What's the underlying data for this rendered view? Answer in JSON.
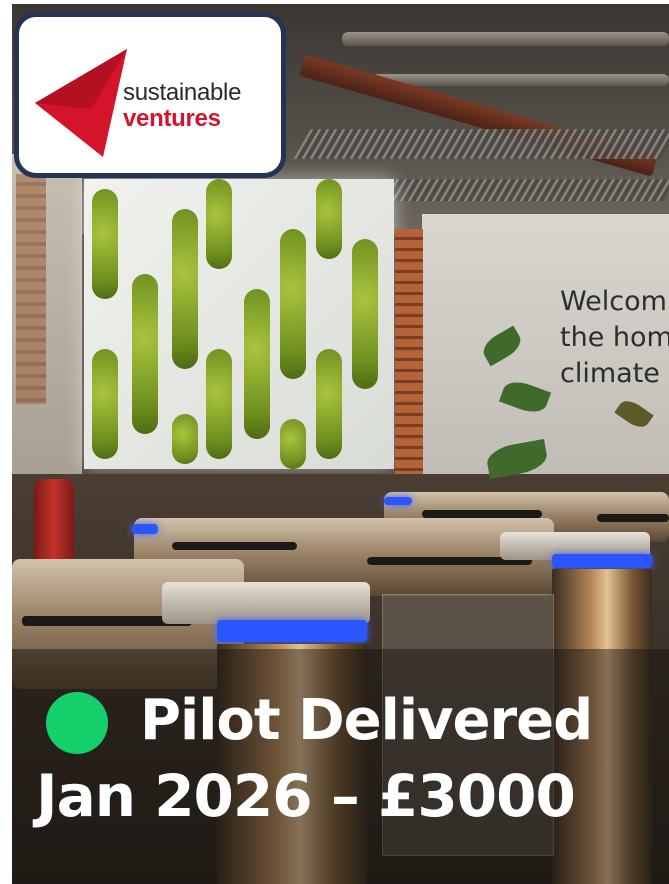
{
  "logo": {
    "line1": "sustainable",
    "line2": "ventures",
    "icon": "red-triangle-logo-icon",
    "brand_color": "#d4142a",
    "border_color": "#243457"
  },
  "background": {
    "wall_sign": [
      "Welcom",
      "the hom",
      "climate"
    ]
  },
  "status": {
    "indicator_color": "#14d06a",
    "headline": "Pilot Delivered",
    "detail": "Jan 2026 – £3000"
  }
}
